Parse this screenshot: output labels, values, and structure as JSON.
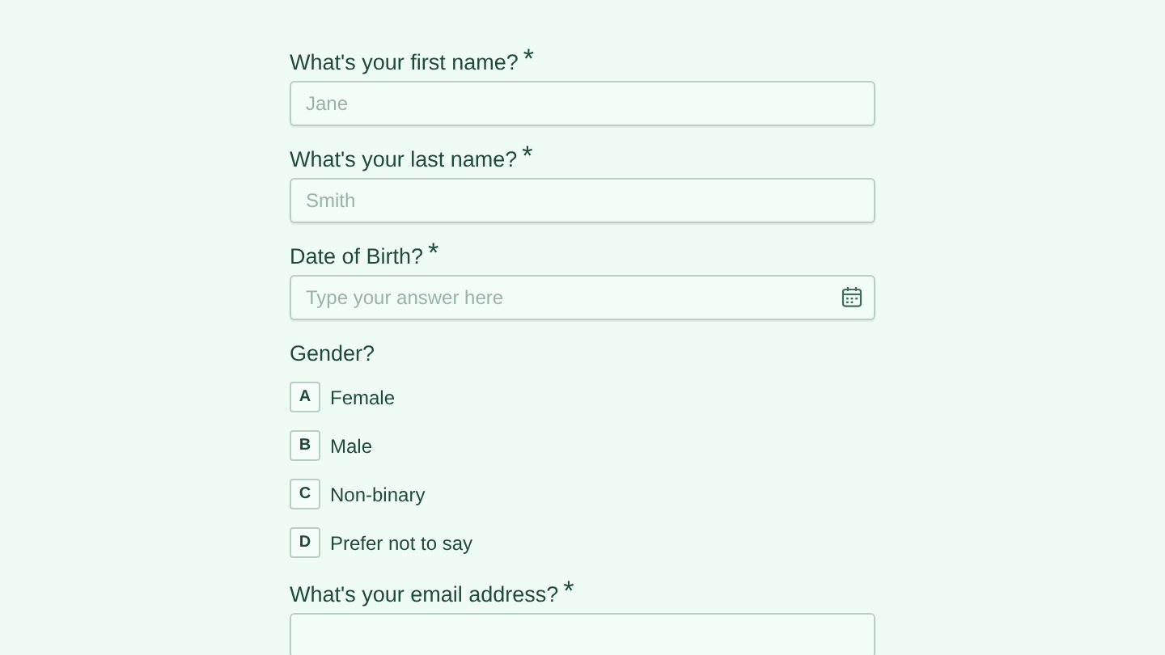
{
  "questions": [
    {
      "kind": "text",
      "label": "What's your first name?",
      "required_mark": "*",
      "placeholder": "Jane"
    },
    {
      "kind": "text",
      "label": "What's your last name?",
      "required_mark": "*",
      "placeholder": "Smith"
    },
    {
      "kind": "date",
      "label": "Date of Birth?",
      "required_mark": "*",
      "placeholder": "Type your answer here"
    },
    {
      "kind": "choice",
      "label": "Gender?",
      "options": [
        {
          "key": "A",
          "label": "Female",
          "selected": false
        },
        {
          "key": "B",
          "label": "Male",
          "selected": false
        },
        {
          "key": "C",
          "label": "Non-binary",
          "selected": false
        },
        {
          "key": "D",
          "label": "Prefer not to say",
          "selected": false
        }
      ]
    },
    {
      "kind": "text",
      "label": "What's your email address?",
      "required_mark": "*"
    }
  ]
}
